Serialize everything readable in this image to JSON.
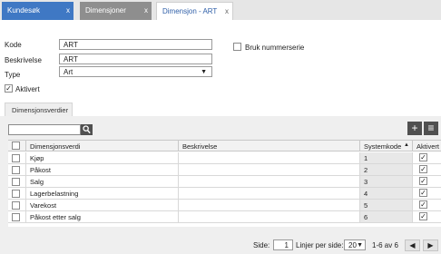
{
  "tabs": [
    {
      "label": "Kundesøk",
      "close": "x"
    },
    {
      "label": "Dimensjoner",
      "close": "x"
    },
    {
      "label": "Dimensjon - ART",
      "close": "x"
    }
  ],
  "form": {
    "kode_label": "Kode",
    "kode_value": "ART",
    "beskrivelse_label": "Beskrivelse",
    "beskrivelse_value": "ART",
    "type_label": "Type",
    "type_value": "Art",
    "bruk_nummerserie_label": "Bruk nummerserie",
    "aktivert_label": "Aktivert"
  },
  "subtab": {
    "label": "Dimensjonsverdier"
  },
  "grid": {
    "headers": {
      "dimensjonsverdi": "Dimensjonsverdi",
      "beskrivelse": "Beskrivelse",
      "systemkode": "Systemkode",
      "aktivert": "Aktivert"
    },
    "rows": [
      {
        "verdi": "Kjøp",
        "beskrivelse": "",
        "systemkode": "1",
        "aktivert": true
      },
      {
        "verdi": "Påkost",
        "beskrivelse": "",
        "systemkode": "2",
        "aktivert": true
      },
      {
        "verdi": "Salg",
        "beskrivelse": "",
        "systemkode": "3",
        "aktivert": true
      },
      {
        "verdi": "Lagerbelastning",
        "beskrivelse": "",
        "systemkode": "4",
        "aktivert": true
      },
      {
        "verdi": "Varekost",
        "beskrivelse": "",
        "systemkode": "5",
        "aktivert": true
      },
      {
        "verdi": "Påkost etter salg",
        "beskrivelse": "",
        "systemkode": "6",
        "aktivert": true
      }
    ]
  },
  "footer": {
    "side_label": "Side:",
    "side_value": "1",
    "linjer_label": "Linjer per side:",
    "linjer_value": "20",
    "range": "1-6 av 6"
  },
  "icons": {
    "add": "+",
    "menu": "≡",
    "prev": "◀",
    "next": "▶",
    "check": "✓",
    "dropdown": "▼"
  }
}
